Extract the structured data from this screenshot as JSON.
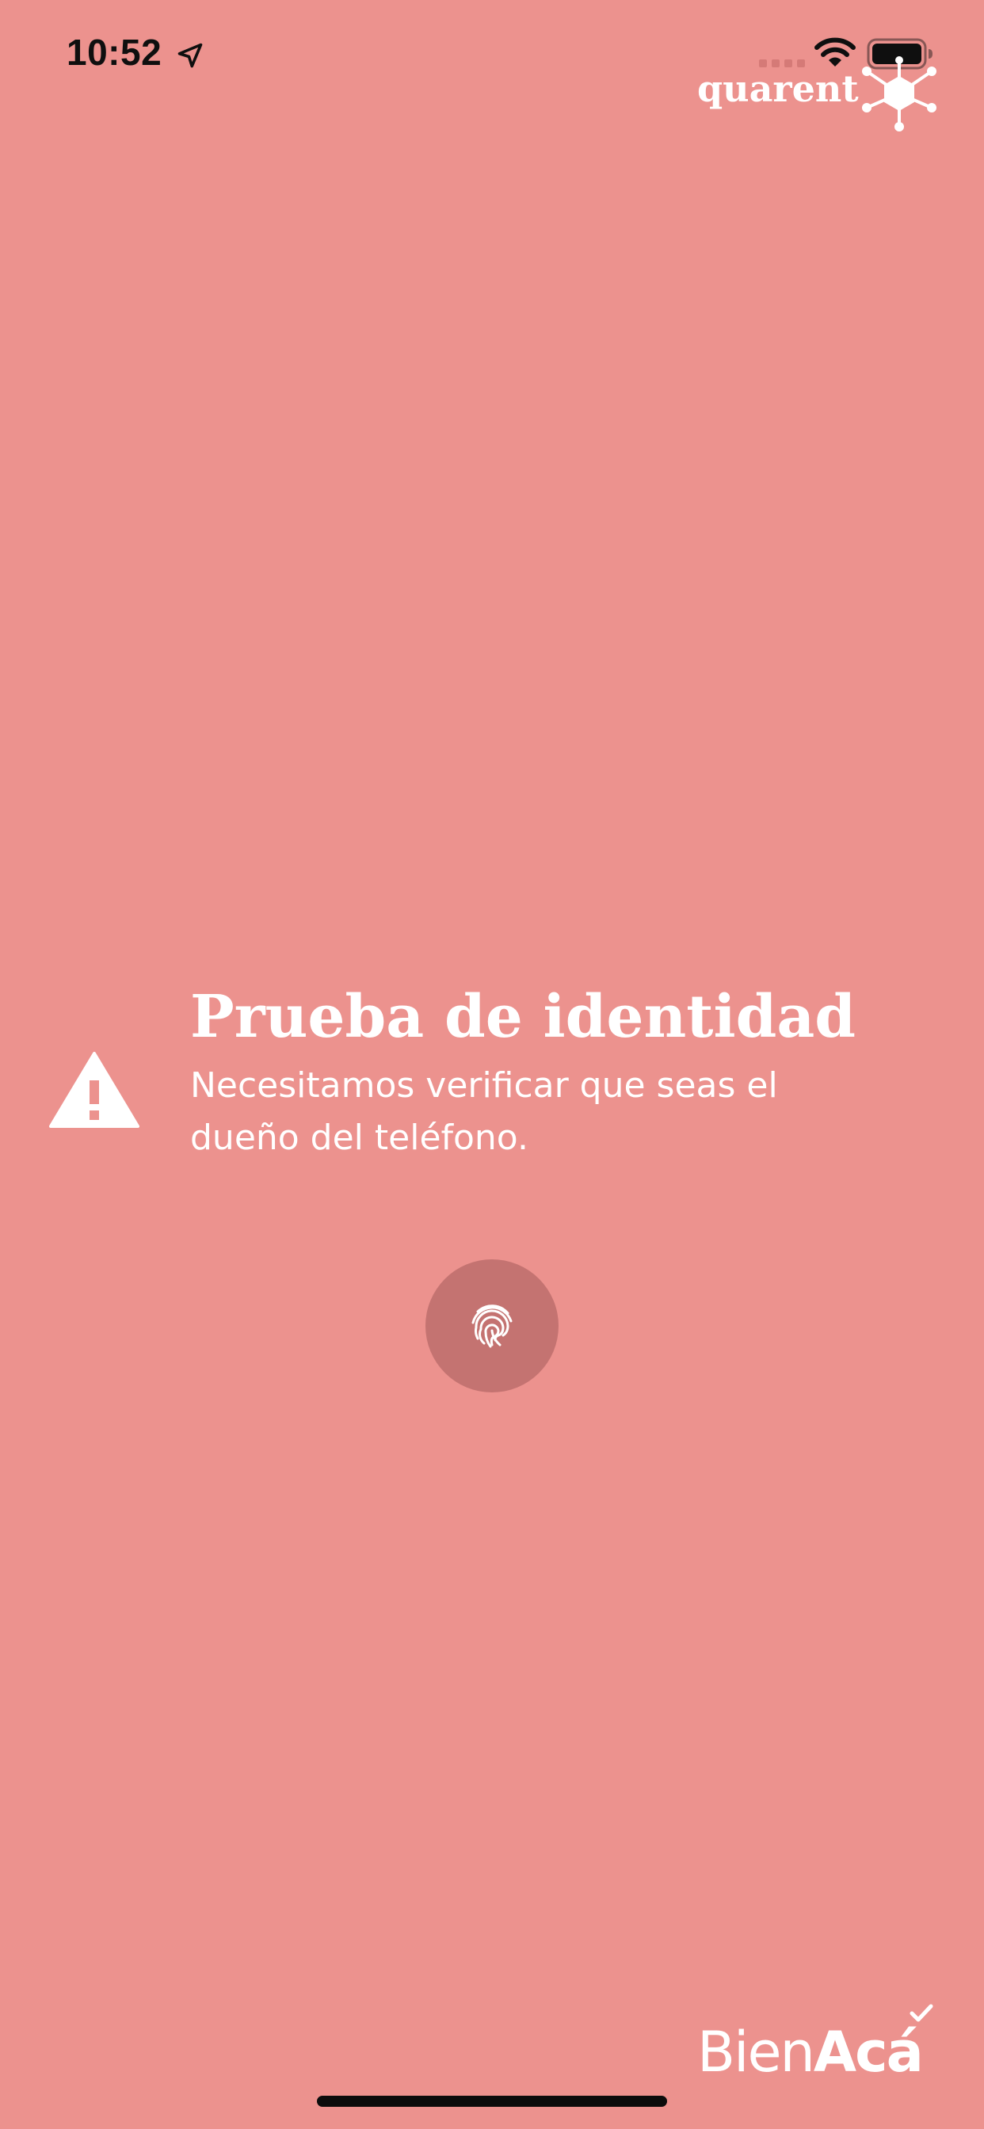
{
  "status_bar": {
    "time": "10:52",
    "icons": [
      "location-arrow-icon",
      "signal-icon",
      "wifi-icon",
      "battery-icon"
    ]
  },
  "brand": {
    "name": "quarent",
    "logo_icon": "network-hexagon-icon"
  },
  "main": {
    "warning_icon": "warning-triangle-icon",
    "title": "Prueba de identidad",
    "message": "Necesitamos verificar que seas el dueño del teléfono."
  },
  "fingerprint_button": {
    "icon": "fingerprint-icon"
  },
  "footer": {
    "logo_light": "Bien",
    "logo_bold": "Acá"
  },
  "colors": {
    "background": "#EC928E",
    "button": "#C47371",
    "text": "#FFFFFF"
  }
}
